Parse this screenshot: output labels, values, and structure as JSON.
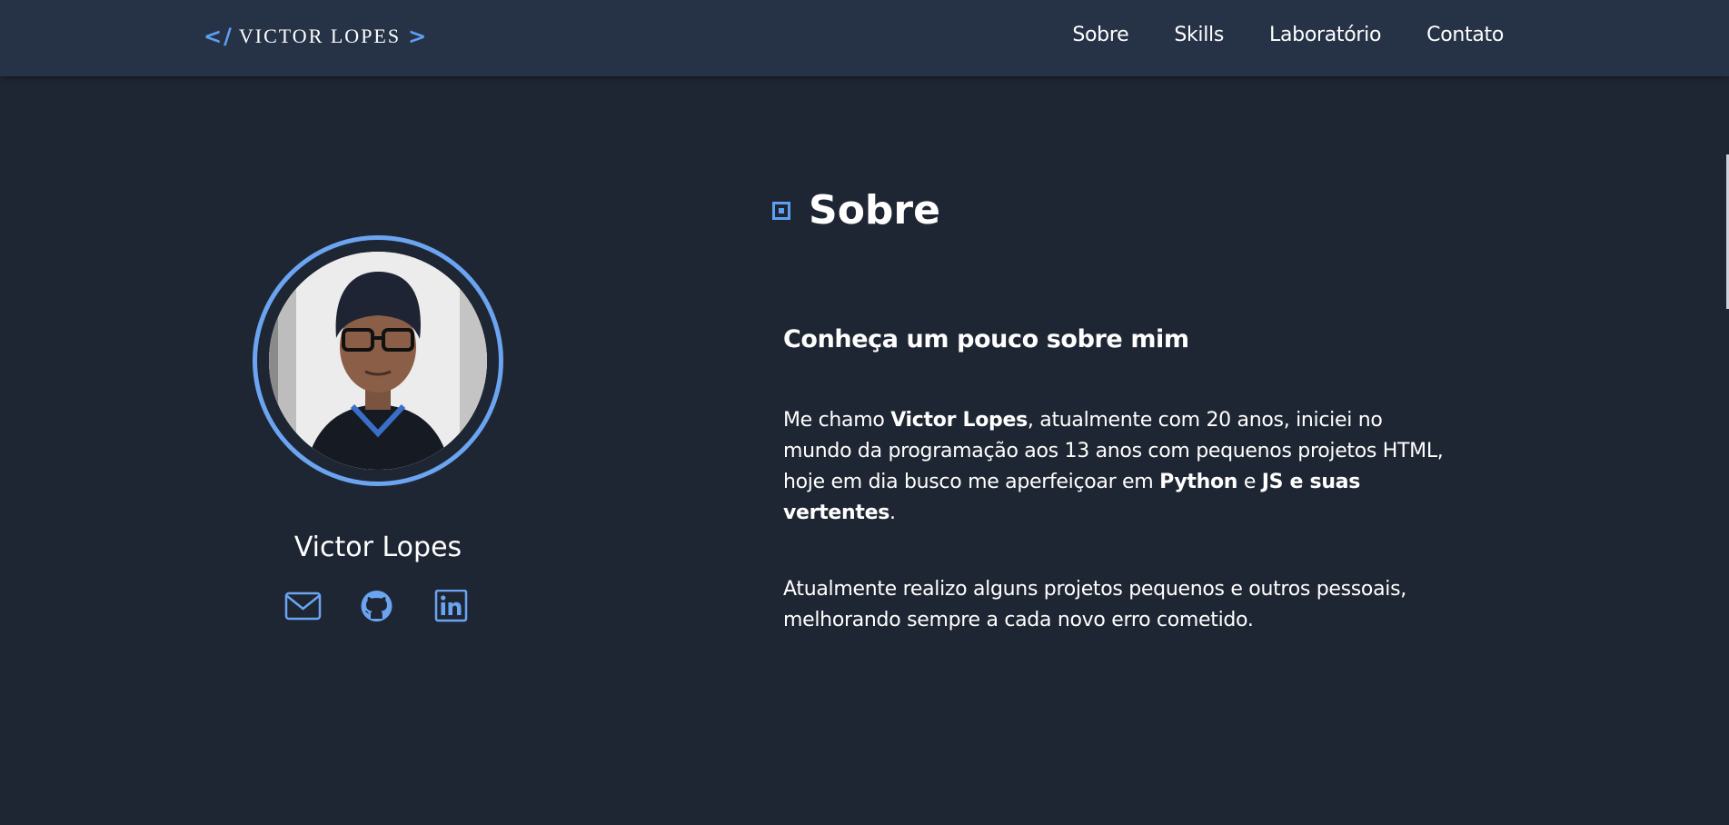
{
  "header": {
    "logo": {
      "left_bracket": "</",
      "name": "VICTOR LOPES",
      "right_bracket": ">"
    },
    "nav": [
      {
        "label": "Sobre"
      },
      {
        "label": "Skills"
      },
      {
        "label": "Laboratório"
      },
      {
        "label": "Contato"
      }
    ]
  },
  "profile": {
    "name": "Victor Lopes",
    "socials": [
      {
        "icon": "envelope-icon"
      },
      {
        "icon": "github-icon"
      },
      {
        "icon": "linkedin-icon"
      }
    ]
  },
  "about": {
    "title": "Sobre",
    "subtitle": "Conheça um pouco sobre mim",
    "paragraph1": {
      "t1": "Me chamo ",
      "b1": "Victor Lopes",
      "t2": ", atualmente com 20 anos, iniciei no mundo da programação aos 13 anos com pequenos projetos HTML, hoje em dia busco me aperfeiçoar em ",
      "b2": "Python",
      "t3": " e ",
      "b3": "JS e suas vertentes",
      "t4": "."
    },
    "paragraph2": "Atualmente realizo alguns projetos pequenos e outros pessoais, melhorando sempre a cada novo erro cometido."
  },
  "colors": {
    "background": "#1f2633",
    "navbar": "#263347",
    "accent": "#6ba5f2",
    "text": "#ffffff"
  }
}
